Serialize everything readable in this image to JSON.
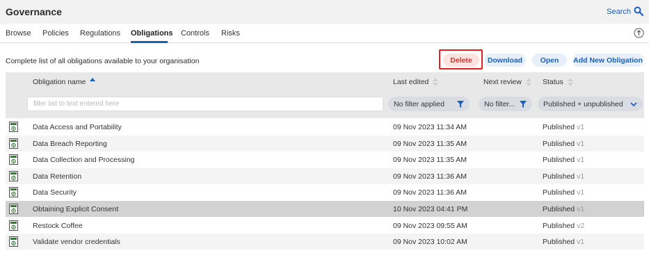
{
  "app": {
    "title": "Governance",
    "search_label": "Search"
  },
  "tabs": [
    {
      "label": "Browse",
      "active": false
    },
    {
      "label": "Policies",
      "active": false
    },
    {
      "label": "Regulations",
      "active": false
    },
    {
      "label": "Obligations",
      "active": true
    },
    {
      "label": "Controls",
      "active": false
    },
    {
      "label": "Risks",
      "active": false
    }
  ],
  "toolbar": {
    "description": "Complete list of all obligations available to your organisation",
    "delete_label": "Delete",
    "download_label": "Download",
    "open_label": "Open",
    "add_label": "Add New Obligation"
  },
  "columns": {
    "name": "Obligation name",
    "last_edited": "Last edited",
    "next_review": "Next review",
    "status": "Status"
  },
  "filters": {
    "name_placeholder": "filter list to text entered here",
    "last_edited": "No filter applied",
    "next_review": "No filter...",
    "status": "Published + unpublished"
  },
  "rows": [
    {
      "name": "Data Access and Portability",
      "edited": "09 Nov 2023 11:34 AM",
      "status": "Published",
      "version": "v1",
      "selected": false
    },
    {
      "name": "Data Breach Reporting",
      "edited": "09 Nov 2023 11:35 AM",
      "status": "Published",
      "version": "v1",
      "selected": false
    },
    {
      "name": "Data Collection and Processing",
      "edited": "09 Nov 2023 11:35 AM",
      "status": "Published",
      "version": "v1",
      "selected": false
    },
    {
      "name": "Data Retention",
      "edited": "09 Nov 2023 11:36 AM",
      "status": "Published",
      "version": "v1",
      "selected": false
    },
    {
      "name": "Data Security",
      "edited": "09 Nov 2023 11:36 AM",
      "status": "Published",
      "version": "v1",
      "selected": false
    },
    {
      "name": "Obtaining Explicit Consent",
      "edited": "10 Nov 2023 04:41 PM",
      "status": "Published",
      "version": "v1",
      "selected": true
    },
    {
      "name": "Restock Coffee",
      "edited": "09 Nov 2023 09:55 AM",
      "status": "Published",
      "version": "v2",
      "selected": false
    },
    {
      "name": "Validate vendor credentials",
      "edited": "09 Nov 2023 10:02 AM",
      "status": "Published",
      "version": "v1",
      "selected": false
    }
  ],
  "colors": {
    "accent": "#1b5fbe",
    "danger": "#d9302f",
    "selected_row": "#d2d2d2"
  },
  "icons": {
    "row": "obligation-document-icon",
    "search": "search-icon",
    "upload": "upload-icon"
  }
}
